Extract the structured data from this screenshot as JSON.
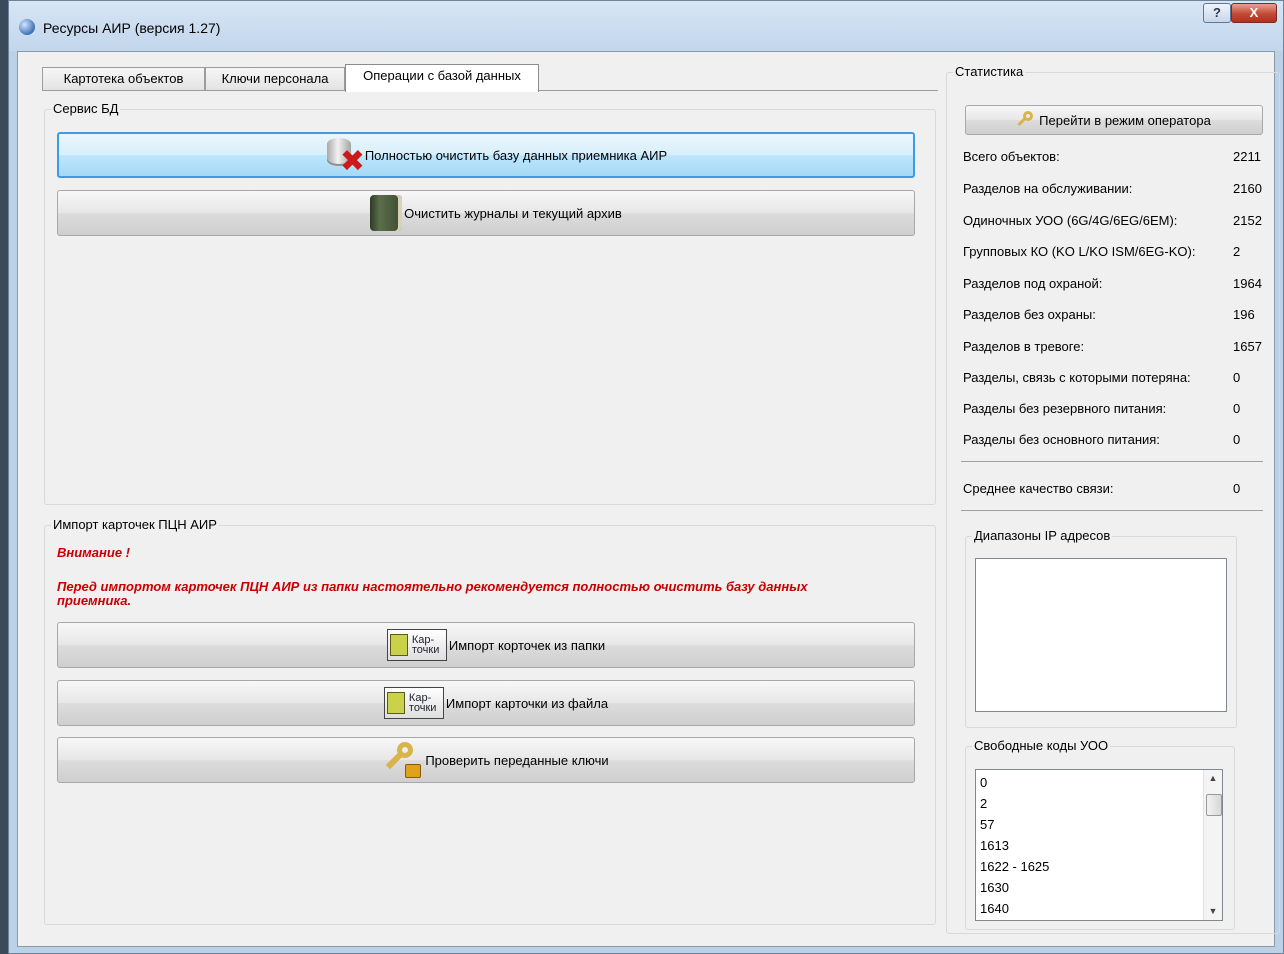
{
  "window": {
    "title": "Ресурсы АИР (версия 1.27)",
    "help": "?",
    "close": "X"
  },
  "tabs": [
    {
      "label": "Картотека объектов"
    },
    {
      "label": "Ключи персонала"
    },
    {
      "label": "Операции с базой данных"
    }
  ],
  "service": {
    "title": "Сервис БД",
    "clear_db": "Полностью очистить базу данных приемника АИР",
    "clear_logs": "Очистить журналы и текущий архив"
  },
  "import": {
    "title": "Импорт карточек ПЦН АИР",
    "warning_title": "Внимание !",
    "warning_text_line1": "Перед импортом карточек ПЦН АИР из папки настоятельно рекомендуется полностью очистить базу данных",
    "warning_text_line2": "приемника.",
    "card_icon_text_1": "Кар-",
    "card_icon_text_2": "точки",
    "import_folder": "Импорт корточек из папки",
    "import_file": "Импорт карточки из файла",
    "check_keys": "Проверить переданные ключи"
  },
  "stats": {
    "title": "Статистика",
    "operator_button": "Перейти в режим оператора",
    "rows": [
      {
        "label": "Всего объектов:",
        "value": "2211"
      },
      {
        "label": "Разделов на обслуживании:",
        "value": "2160"
      },
      {
        "label": "Одиночных УОО (6G/4G/6EG/6EM):",
        "value": "2152"
      },
      {
        "label": "Групповых КО (KO L/KO ISM/6EG-KO):",
        "value": "2"
      },
      {
        "label": "Разделов под охраной:",
        "value": "1964"
      },
      {
        "label": "Разделов без охраны:",
        "value": "196"
      },
      {
        "label": "Разделов в тревоге:",
        "value": "1657"
      },
      {
        "label": "Разделы, связь с которыми потеряна:",
        "value": "0"
      },
      {
        "label": "Разделы без резервного питания:",
        "value": "0"
      },
      {
        "label": "Разделы без основного питания:",
        "value": "0"
      }
    ],
    "avg_quality_label": "Среднее качество связи:",
    "avg_quality_value": "0",
    "ip_ranges_title": "Диапазоны IP адресов",
    "free_codes_title": "Свободные коды УОО",
    "free_codes": [
      "0",
      "2",
      "57",
      "1613",
      "1622 - 1625",
      "1630",
      "1640"
    ]
  }
}
